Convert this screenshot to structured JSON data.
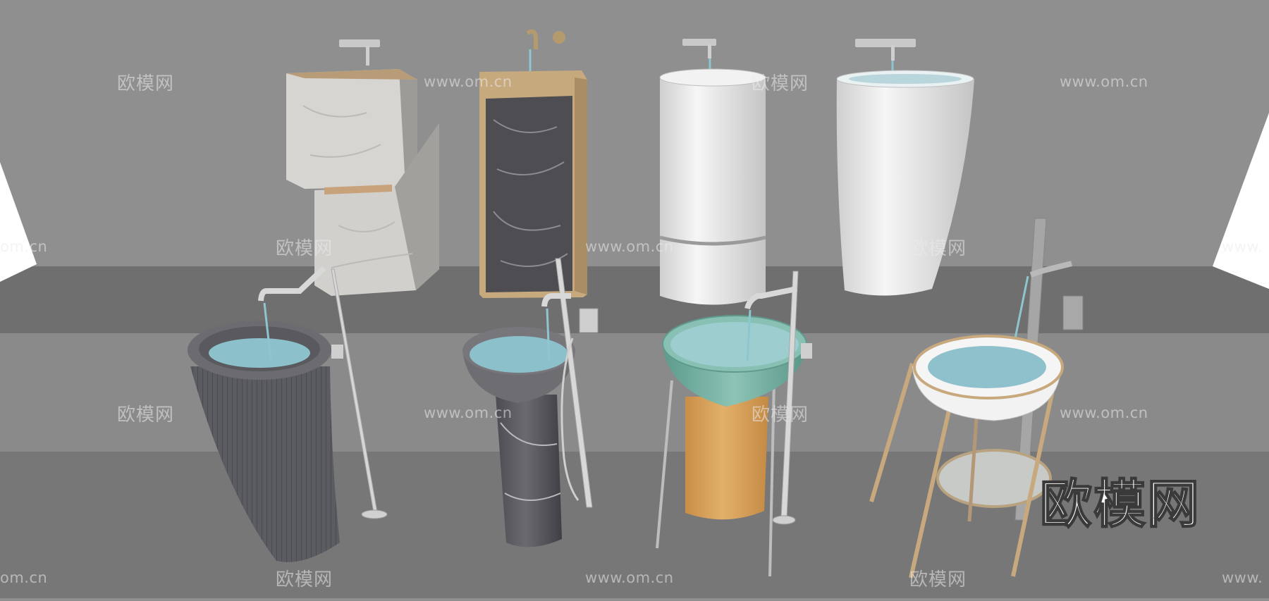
{
  "watermarks": {
    "brand_cn": "欧模网",
    "site_url": "www.om.cn",
    "site_url_cropped": "om.cn",
    "site_url_cropped_right": "www."
  },
  "colors": {
    "background_wall": "#8f8f8f",
    "back_shelf": "#6f6f6f",
    "floor": "#777777",
    "light_marble": "#d8d6d2",
    "dark_marble": "#4a4a4e",
    "wood_frame": "#c9a878",
    "white_ceramic": "#ececec",
    "teal_basin": "#79b3a6",
    "orange_pedestal": "#d9a45f",
    "water": "#8cc1cc",
    "chrome": "#d7d7d7"
  },
  "objects": [
    {
      "name": "wall-mounted-marble-cube-sink"
    },
    {
      "name": "wall-mounted-dark-marble-framed-sink"
    },
    {
      "name": "wall-mounted-white-cylinder-sink"
    },
    {
      "name": "wall-mounted-white-tapered-sink"
    },
    {
      "name": "textured-grey-pedestal-sink"
    },
    {
      "name": "grey-marble-bowl-pedestal-sink"
    },
    {
      "name": "teal-basin-orange-pedestal-sink"
    },
    {
      "name": "white-basin-brass-stand-sink"
    }
  ]
}
